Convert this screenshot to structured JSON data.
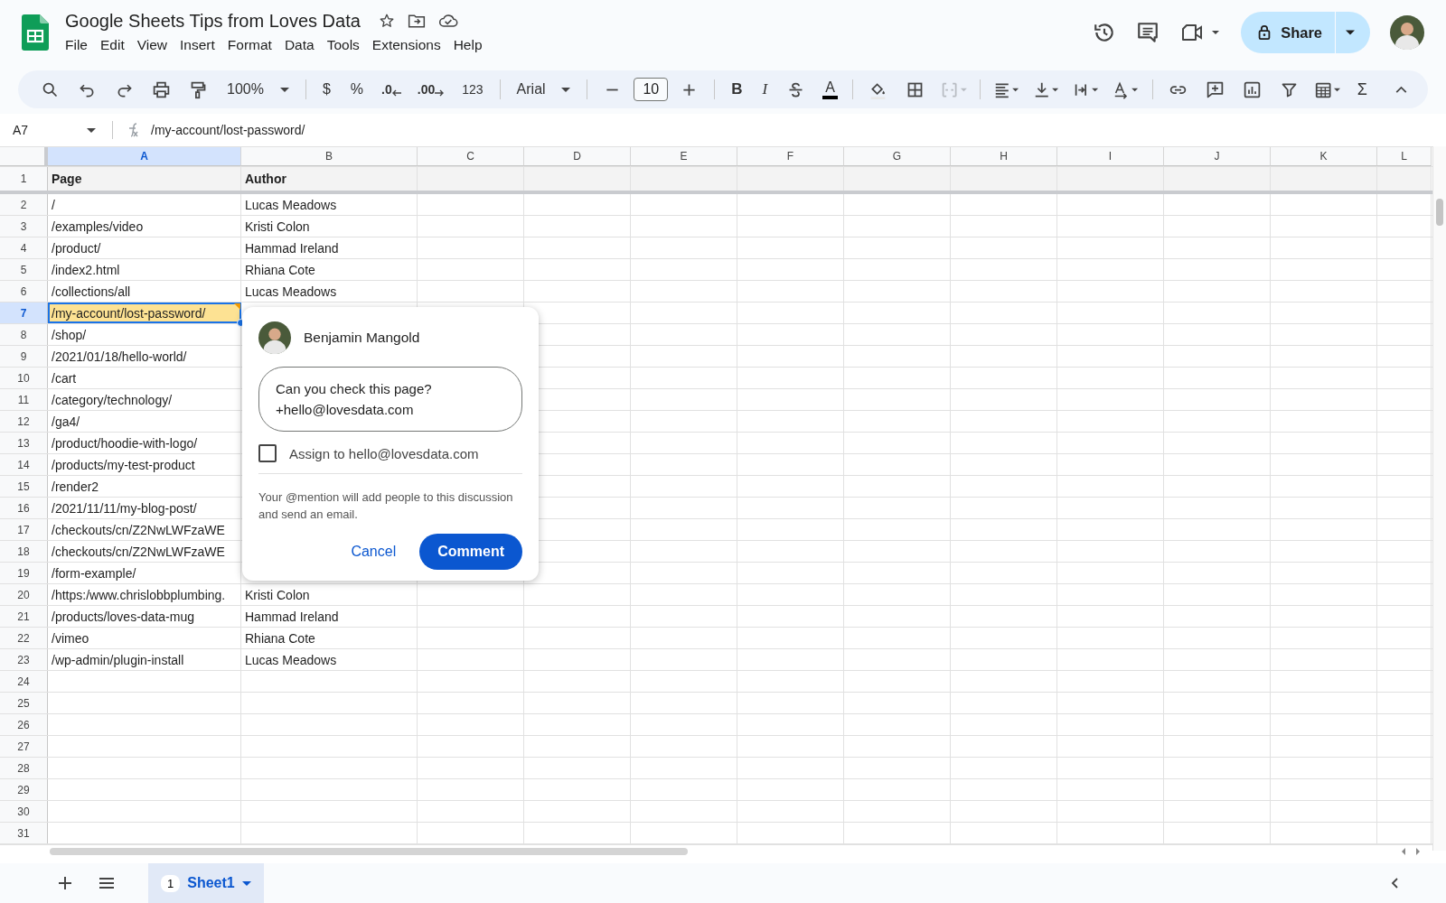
{
  "document": {
    "title": "Google Sheets Tips from Loves Data",
    "starred": false
  },
  "menu": [
    "File",
    "Edit",
    "View",
    "Insert",
    "Format",
    "Data",
    "Tools",
    "Extensions",
    "Help"
  ],
  "share_button": "Share",
  "toolbar": {
    "zoom": "100%",
    "currency": "$",
    "percent": "%",
    "decrease_decimals": ".0",
    "increase_decimals": ".00",
    "number_formats": "123",
    "font": "Arial",
    "font_size": "10",
    "bold": "B",
    "italic": "I",
    "text_color": "A",
    "functions": "Σ"
  },
  "formula_bar": {
    "cell_ref": "A7",
    "value": "/my-account/lost-password/"
  },
  "columns": [
    {
      "label": "A",
      "selected": true
    },
    {
      "label": "B",
      "selected": false
    },
    {
      "label": "C",
      "selected": false
    },
    {
      "label": "D",
      "selected": false
    },
    {
      "label": "E",
      "selected": false
    },
    {
      "label": "F",
      "selected": false
    },
    {
      "label": "G",
      "selected": false
    },
    {
      "label": "H",
      "selected": false
    },
    {
      "label": "I",
      "selected": false
    },
    {
      "label": "J",
      "selected": false
    },
    {
      "label": "K",
      "selected": false
    },
    {
      "label": "L",
      "selected": false
    }
  ],
  "rows": [
    {
      "number": "1",
      "kind": "header",
      "selected": false,
      "cells": [
        "Page",
        "Author"
      ]
    },
    {
      "number": "2",
      "kind": "data",
      "selected": false,
      "cells": [
        "/",
        "Lucas Meadows"
      ]
    },
    {
      "number": "3",
      "kind": "data",
      "selected": false,
      "cells": [
        "/examples/video",
        "Kristi Colon"
      ]
    },
    {
      "number": "4",
      "kind": "data",
      "selected": false,
      "cells": [
        "/product/",
        "Hammad Ireland"
      ]
    },
    {
      "number": "5",
      "kind": "data",
      "selected": false,
      "cells": [
        "/index2.html",
        "Rhiana Cote"
      ]
    },
    {
      "number": "6",
      "kind": "data",
      "selected": false,
      "cells": [
        "/collections/all",
        "Lucas Meadows"
      ]
    },
    {
      "number": "7",
      "kind": "data",
      "selected": true,
      "cells": [
        "/my-account/lost-password/"
      ]
    },
    {
      "number": "8",
      "kind": "data",
      "selected": false,
      "cells": [
        "/shop/"
      ]
    },
    {
      "number": "9",
      "kind": "data",
      "selected": false,
      "cells": [
        "/2021/01/18/hello-world/"
      ]
    },
    {
      "number": "10",
      "kind": "data",
      "selected": false,
      "cells": [
        "/cart"
      ]
    },
    {
      "number": "11",
      "kind": "data",
      "selected": false,
      "cells": [
        "/category/technology/"
      ]
    },
    {
      "number": "12",
      "kind": "data",
      "selected": false,
      "cells": [
        "/ga4/"
      ]
    },
    {
      "number": "13",
      "kind": "data",
      "selected": false,
      "cells": [
        "/product/hoodie-with-logo/"
      ]
    },
    {
      "number": "14",
      "kind": "data",
      "selected": false,
      "cells": [
        "/products/my-test-product"
      ]
    },
    {
      "number": "15",
      "kind": "data",
      "selected": false,
      "cells": [
        "/render2"
      ]
    },
    {
      "number": "16",
      "kind": "data",
      "selected": false,
      "cells": [
        "/2021/11/11/my-blog-post/"
      ]
    },
    {
      "number": "17",
      "kind": "data",
      "selected": false,
      "cells": [
        "/checkouts/cn/Z2NwLWFzaWE"
      ]
    },
    {
      "number": "18",
      "kind": "data",
      "selected": false,
      "cells": [
        "/checkouts/cn/Z2NwLWFzaWE"
      ]
    },
    {
      "number": "19",
      "kind": "data",
      "selected": false,
      "cells": [
        "/form-example/"
      ]
    },
    {
      "number": "20",
      "kind": "data",
      "selected": false,
      "cells": [
        "/https:/www.chrislobbplumbing.",
        "Kristi Colon"
      ]
    },
    {
      "number": "21",
      "kind": "data",
      "selected": false,
      "cells": [
        "/products/loves-data-mug",
        "Hammad Ireland"
      ]
    },
    {
      "number": "22",
      "kind": "data",
      "selected": false,
      "cells": [
        "/vimeo",
        "Rhiana Cote"
      ]
    },
    {
      "number": "23",
      "kind": "data",
      "selected": false,
      "cells": [
        "/wp-admin/plugin-install",
        "Lucas Meadows"
      ]
    },
    {
      "number": "24",
      "kind": "data",
      "selected": false,
      "cells": []
    },
    {
      "number": "25",
      "kind": "data",
      "selected": false,
      "cells": []
    },
    {
      "number": "26",
      "kind": "data",
      "selected": false,
      "cells": []
    },
    {
      "number": "27",
      "kind": "data",
      "selected": false,
      "cells": []
    },
    {
      "number": "28",
      "kind": "data",
      "selected": false,
      "cells": []
    },
    {
      "number": "29",
      "kind": "data",
      "selected": false,
      "cells": []
    },
    {
      "number": "30",
      "kind": "data",
      "selected": false,
      "cells": []
    },
    {
      "number": "31",
      "kind": "data",
      "selected": false,
      "cells": []
    }
  ],
  "comment_popup": {
    "author": "Benjamin Mangold",
    "draft": "Can you check this page?\n+hello@lovesdata.com",
    "assign": {
      "label": "Assign to hello@lovesdata.com",
      "checked": false
    },
    "hint": "Your @mention will add people to this discussion and send an email.",
    "cancel": "Cancel",
    "submit": "Comment"
  },
  "sheets": [
    {
      "number": "1",
      "name": "Sheet1",
      "selected": true
    }
  ]
}
